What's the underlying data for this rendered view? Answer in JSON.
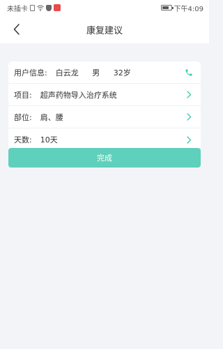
{
  "status_bar": {
    "carrier": "未插卡",
    "time": "下午4:09"
  },
  "header": {
    "title": "康复建议"
  },
  "user_info": {
    "label": "用户信息:",
    "name": "白云龙",
    "gender": "男",
    "age": "32岁"
  },
  "rows": [
    {
      "label": "项目:",
      "value": "超声药物导入治疗系统"
    },
    {
      "label": "部位:",
      "value": "肩、腰"
    },
    {
      "label": "天数:",
      "value": "10天"
    }
  ],
  "actions": {
    "done_label": "完成"
  },
  "colors": {
    "accent": "#5fd0bb",
    "icon_teal": "#3ec7aa",
    "background": "#f2f4f8"
  }
}
